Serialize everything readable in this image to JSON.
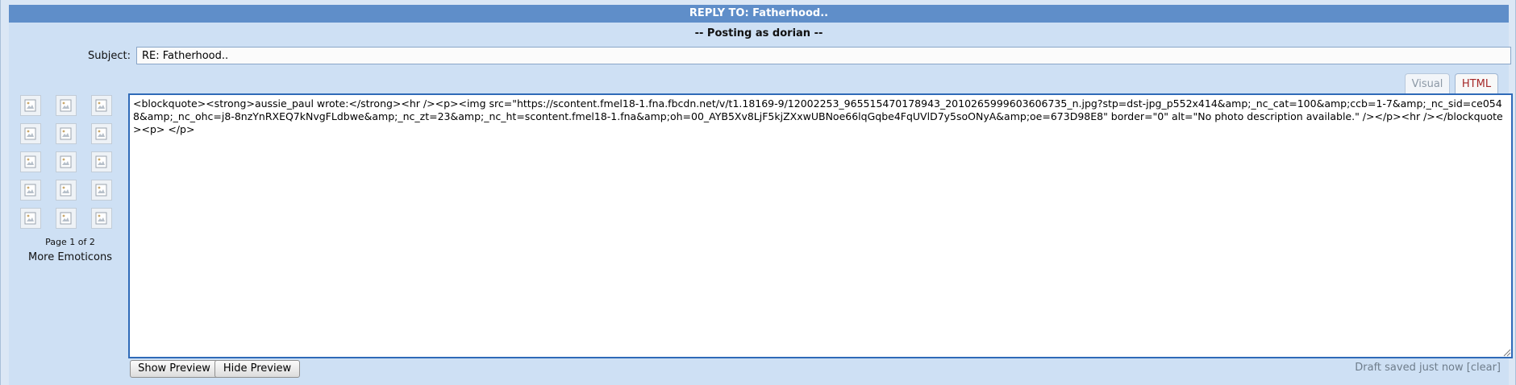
{
  "header": {
    "title": "REPLY TO: Fatherhood..",
    "posting_as": "-- Posting as dorian --"
  },
  "subject": {
    "label": "Subject:",
    "value": "RE: Fatherhood.."
  },
  "editor_tabs": [
    {
      "label": "Visual",
      "active": false
    },
    {
      "label": "HTML",
      "active": true
    }
  ],
  "emoticons": {
    "icon": "broken-image-icon",
    "count": 15,
    "page_info": "Page 1 of 2",
    "more_label": "More Emoticons"
  },
  "editor": {
    "content": "<blockquote><strong>aussie_paul wrote:</strong><hr /><p><img src=\"https://scontent.fmel18-1.fna.fbcdn.net/v/t1.18169-9/12002253_965515470178943_2010265999603606735_n.jpg?stp=dst-jpg_p552x414&amp;_nc_cat=100&amp;ccb=1-7&amp;_nc_sid=ce0548&amp;_nc_ohc=j8-8nzYnRXEQ7kNvgFLdbwe&amp;_nc_zt=23&amp;_nc_ht=scontent.fmel18-1.fna&amp;oh=00_AYB5Xv8LjF5kjZXxwUBNoe66lqGqbe4FqUVlD7y5soONyA&amp;oe=673D98E8\" border=\"0\" alt=\"No photo description available.\" /></p><hr /></blockquote><p> </p>"
  },
  "buttons": {
    "show_preview": "Show Preview",
    "hide_preview": "Hide Preview"
  },
  "draft": {
    "status": "Draft saved just now [clear]"
  },
  "colors": {
    "title_bar": "#5f8ec9",
    "panel": "#cee0f4",
    "editor_border": "#2f6ab8",
    "active_tab_text": "#a52828"
  }
}
